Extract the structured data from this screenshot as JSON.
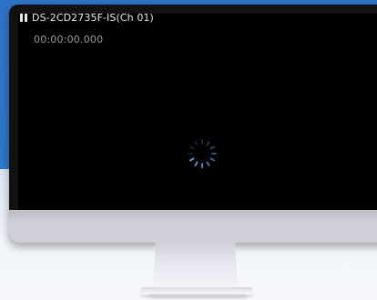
{
  "video": {
    "camera_title": "DS-2CD2735F-IS(Ch 01)",
    "timestamp": "00:00:00.000",
    "state_icon": "pause-icon",
    "loading_icon": "spinner-icon"
  },
  "colors": {
    "background_top": "#2E73C8",
    "screen": "#000000",
    "timestamp_text": "#9A9A9A",
    "spinner": "#4F9BE0"
  }
}
